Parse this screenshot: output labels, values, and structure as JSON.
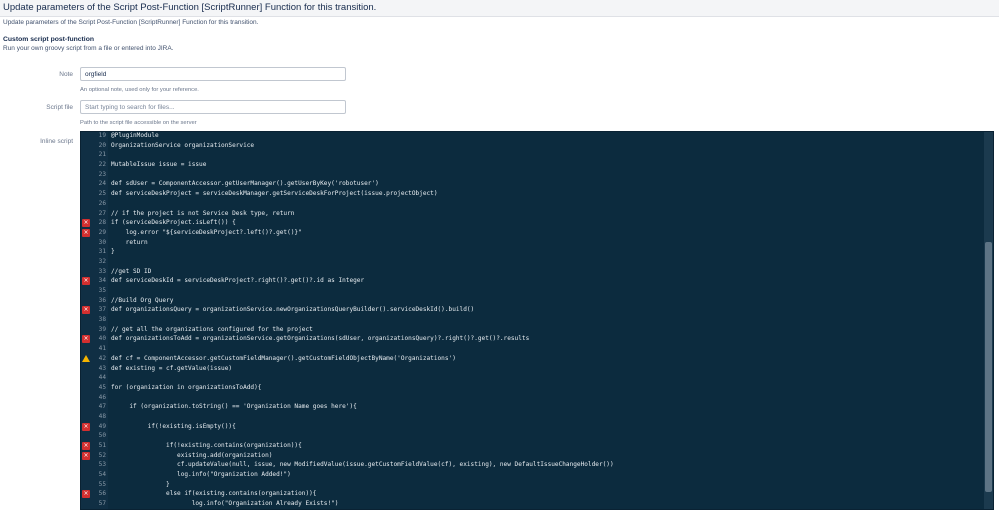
{
  "dialog": {
    "title": "Update parameters of the Script Post-Function [ScriptRunner] Function for this transition.",
    "description": "Update parameters of the Script Post-Function [ScriptRunner] Function for this transition."
  },
  "section": {
    "title": "Custom script post-function",
    "subtitle": "Run your own groovy script from a file or entered into JIRA."
  },
  "note": {
    "label": "Note",
    "value": "orgfield",
    "help": "An optional note, used only for your reference."
  },
  "script_file": {
    "label": "Script file",
    "placeholder": "Start typing to search for files...",
    "help": "Path to the script file accessible on the server"
  },
  "inline_script": {
    "label": "Inline script",
    "lines": [
      {
        "n": "19",
        "marker": "",
        "text": "@PluginModule"
      },
      {
        "n": "20",
        "marker": "",
        "text": "OrganizationService organizationService"
      },
      {
        "n": "21",
        "marker": "",
        "text": ""
      },
      {
        "n": "22",
        "marker": "",
        "text": "MutableIssue issue = issue"
      },
      {
        "n": "23",
        "marker": "",
        "text": ""
      },
      {
        "n": "24",
        "marker": "",
        "text": "def sdUser = ComponentAccessor.getUserManager().getUserByKey('robotuser')"
      },
      {
        "n": "25",
        "marker": "",
        "text": "def serviceDeskProject = serviceDeskManager.getServiceDeskForProject(issue.projectObject)"
      },
      {
        "n": "26",
        "marker": "",
        "text": ""
      },
      {
        "n": "27",
        "marker": "",
        "text": "// if the project is not Service Desk type, return"
      },
      {
        "n": "28",
        "marker": "error",
        "text": "if (serviceDeskProject.isLeft()) {"
      },
      {
        "n": "29",
        "marker": "error",
        "text": "    log.error \"${serviceDeskProject?.left()?.get()}\""
      },
      {
        "n": "30",
        "marker": "",
        "text": "    return"
      },
      {
        "n": "31",
        "marker": "",
        "text": "}"
      },
      {
        "n": "32",
        "marker": "",
        "text": ""
      },
      {
        "n": "33",
        "marker": "",
        "text": "//get SD ID"
      },
      {
        "n": "34",
        "marker": "error",
        "text": "def serviceDeskId = serviceDeskProject?.right()?.get()?.id as Integer"
      },
      {
        "n": "35",
        "marker": "",
        "text": ""
      },
      {
        "n": "36",
        "marker": "",
        "text": "//Build Org Query"
      },
      {
        "n": "37",
        "marker": "error",
        "text": "def organizationsQuery = organizationService.newOrganizationsQueryBuilder().serviceDeskId().build()"
      },
      {
        "n": "38",
        "marker": "",
        "text": ""
      },
      {
        "n": "39",
        "marker": "",
        "text": "// get all the organizations configured for the project"
      },
      {
        "n": "40",
        "marker": "error",
        "text": "def organizationsToAdd = organizationService.getOrganizations(sdUser, organizationsQuery)?.right()?.get()?.results"
      },
      {
        "n": "41",
        "marker": "",
        "text": ""
      },
      {
        "n": "42",
        "marker": "warning",
        "text": "def cf = ComponentAccessor.getCustomFieldManager().getCustomFieldObjectByName('Organizations')"
      },
      {
        "n": "43",
        "marker": "",
        "text": "def existing = cf.getValue(issue)"
      },
      {
        "n": "44",
        "marker": "",
        "text": ""
      },
      {
        "n": "45",
        "marker": "",
        "text": "for (organization in organizationsToAdd){"
      },
      {
        "n": "46",
        "marker": "",
        "text": ""
      },
      {
        "n": "47",
        "marker": "",
        "text": "     if (organization.toString() == 'Organization Name goes here'){"
      },
      {
        "n": "48",
        "marker": "",
        "text": ""
      },
      {
        "n": "49",
        "marker": "error",
        "text": "          if(!existing.isEmpty()){"
      },
      {
        "n": "50",
        "marker": "",
        "text": ""
      },
      {
        "n": "51",
        "marker": "error",
        "text": "               if(!existing.contains(organization)){"
      },
      {
        "n": "52",
        "marker": "error",
        "text": "                  existing.add(organization)"
      },
      {
        "n": "53",
        "marker": "",
        "text": "                  cf.updateValue(null, issue, new ModifiedValue(issue.getCustomFieldValue(cf), existing), new DefaultIssueChangeHolder())"
      },
      {
        "n": "54",
        "marker": "",
        "text": "                  log.info(\"Organization Added!\")"
      },
      {
        "n": "55",
        "marker": "",
        "text": "               }"
      },
      {
        "n": "56",
        "marker": "error",
        "text": "               else if(existing.contains(organization)){"
      },
      {
        "n": "57",
        "marker": "",
        "text": "                      log.info(\"Organization Already Exists!\")"
      }
    ]
  },
  "colors": {
    "editor_bg": "#0c2b3e",
    "error_marker": "#d32f2f",
    "warning_marker": "#f5b400"
  },
  "icons": {
    "error_marker": "error-marker-icon",
    "warning_marker": "warning-marker-icon"
  }
}
